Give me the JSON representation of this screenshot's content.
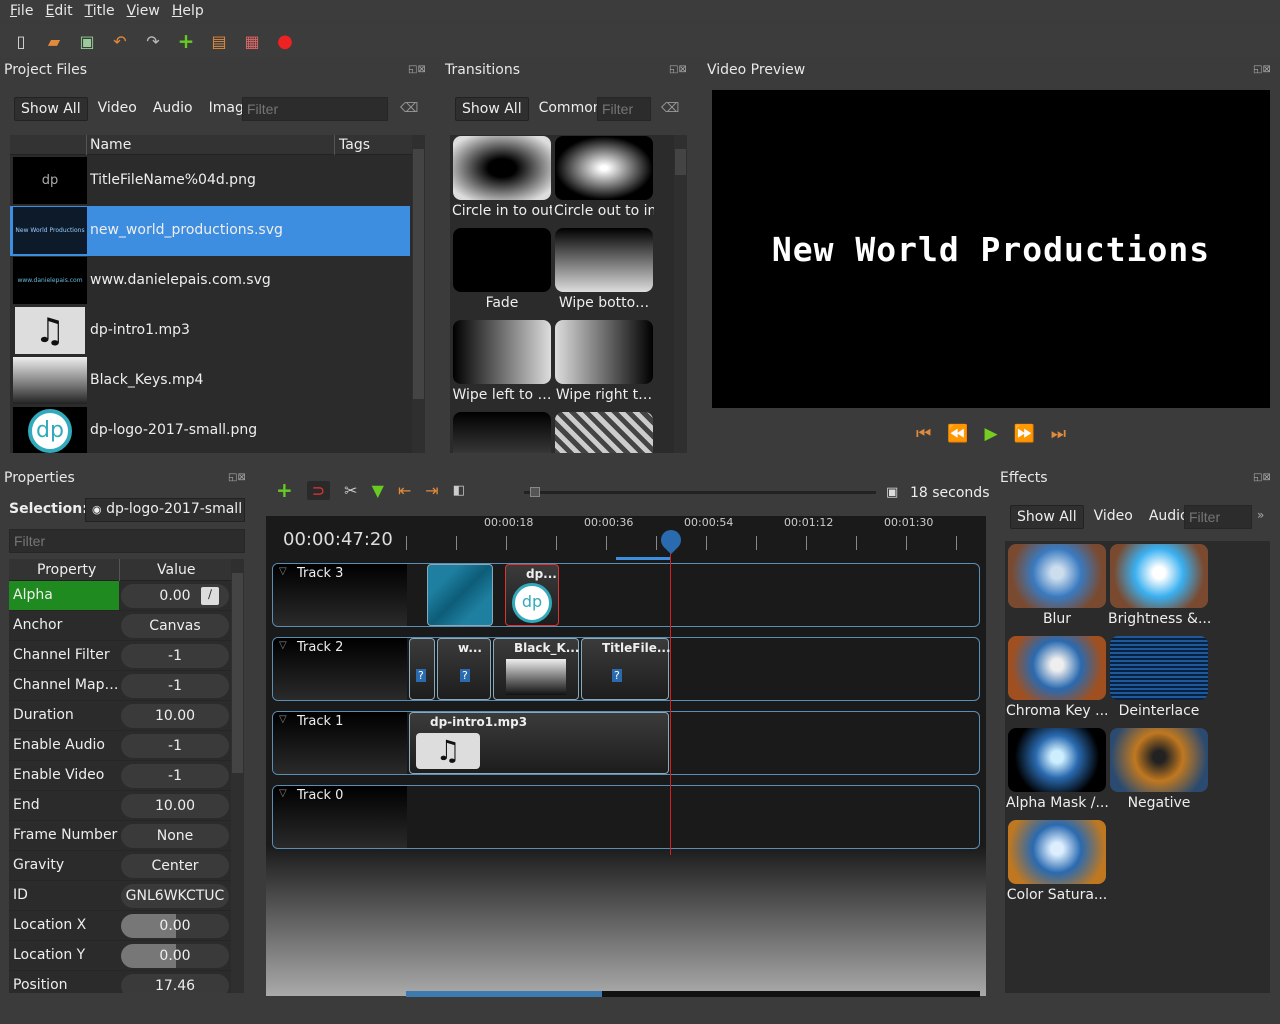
{
  "menu": [
    "File",
    "Edit",
    "Title",
    "View",
    "Help"
  ],
  "toolbar_icons": [
    "new-project-icon",
    "open-project-icon",
    "save-project-icon",
    "undo-icon",
    "redo-icon",
    "import-files-icon",
    "profile-icon",
    "export-icon",
    "record-icon"
  ],
  "project_files": {
    "title": "Project Files",
    "tabs": [
      "Show All",
      "Video",
      "Audio",
      "Image"
    ],
    "filter_placeholder": "Filter",
    "col_name": "Name",
    "col_tags": "Tags",
    "files": [
      "TitleFileName%04d.png",
      "new_world_productions.svg",
      "www.danielepais.com.svg",
      "dp-intro1.mp3",
      "Black_Keys.mp4",
      "dp-logo-2017-small.png"
    ],
    "selected_index": 1,
    "thumb_dp": "dp"
  },
  "transitions": {
    "title": "Transitions",
    "tabs": [
      "Show All",
      "Common"
    ],
    "filter_placeholder": "Filter",
    "items": [
      "Circle in to out",
      "Circle out to in",
      "Fade",
      "Wipe botto…",
      "Wipe left to …",
      "Wipe right t…"
    ]
  },
  "preview": {
    "title": "Video Preview",
    "text": "New World Productions"
  },
  "properties": {
    "title": "Properties",
    "selection_label": "Selection:",
    "selection_value": "dp-logo-2017-small",
    "filter_placeholder": "Filter",
    "col_property": "Property",
    "col_value": "Value",
    "rows": [
      [
        "Alpha",
        "0.00"
      ],
      [
        "Anchor",
        "Canvas"
      ],
      [
        "Channel Filter",
        "-1"
      ],
      [
        "Channel Map…",
        "-1"
      ],
      [
        "Duration",
        "10.00"
      ],
      [
        "Enable Audio",
        "-1"
      ],
      [
        "Enable Video",
        "-1"
      ],
      [
        "End",
        "10.00"
      ],
      [
        "Frame Number",
        "None"
      ],
      [
        "Gravity",
        "Center"
      ],
      [
        "ID",
        "GNL6WKCTUC"
      ],
      [
        "Location X",
        "0.00"
      ],
      [
        "Location Y",
        "0.00"
      ],
      [
        "Position",
        "17.46"
      ]
    ]
  },
  "timeline": {
    "zoom_label": "18 seconds",
    "timecode": "00:00:47:20",
    "ruler": [
      "00:00:18",
      "00:00:36",
      "00:00:54",
      "00:01:12",
      "00:01:30"
    ],
    "tracks": [
      "Track 3",
      "Track 2",
      "Track 1",
      "Track 0"
    ],
    "clips": {
      "t3_b": "dp...",
      "t2_b": "w...",
      "t2_c": "Black_K...",
      "t2_d": "TitleFile...",
      "t1": "dp-intro1.mp3"
    }
  },
  "effects": {
    "title": "Effects",
    "tabs": [
      "Show All",
      "Video",
      "Audio"
    ],
    "filter_placeholder": "Filter",
    "items": [
      "Blur",
      "Brightness &...",
      "Chroma Key ...",
      "Deinterlace",
      "Alpha Mask /...",
      "Negative",
      "Color Satura..."
    ]
  },
  "colors": {
    "selection": "#3d8ee1",
    "alpha_key": "#1f8a1f",
    "playhead": "#d42020",
    "track_border": "#5a8fb5"
  }
}
